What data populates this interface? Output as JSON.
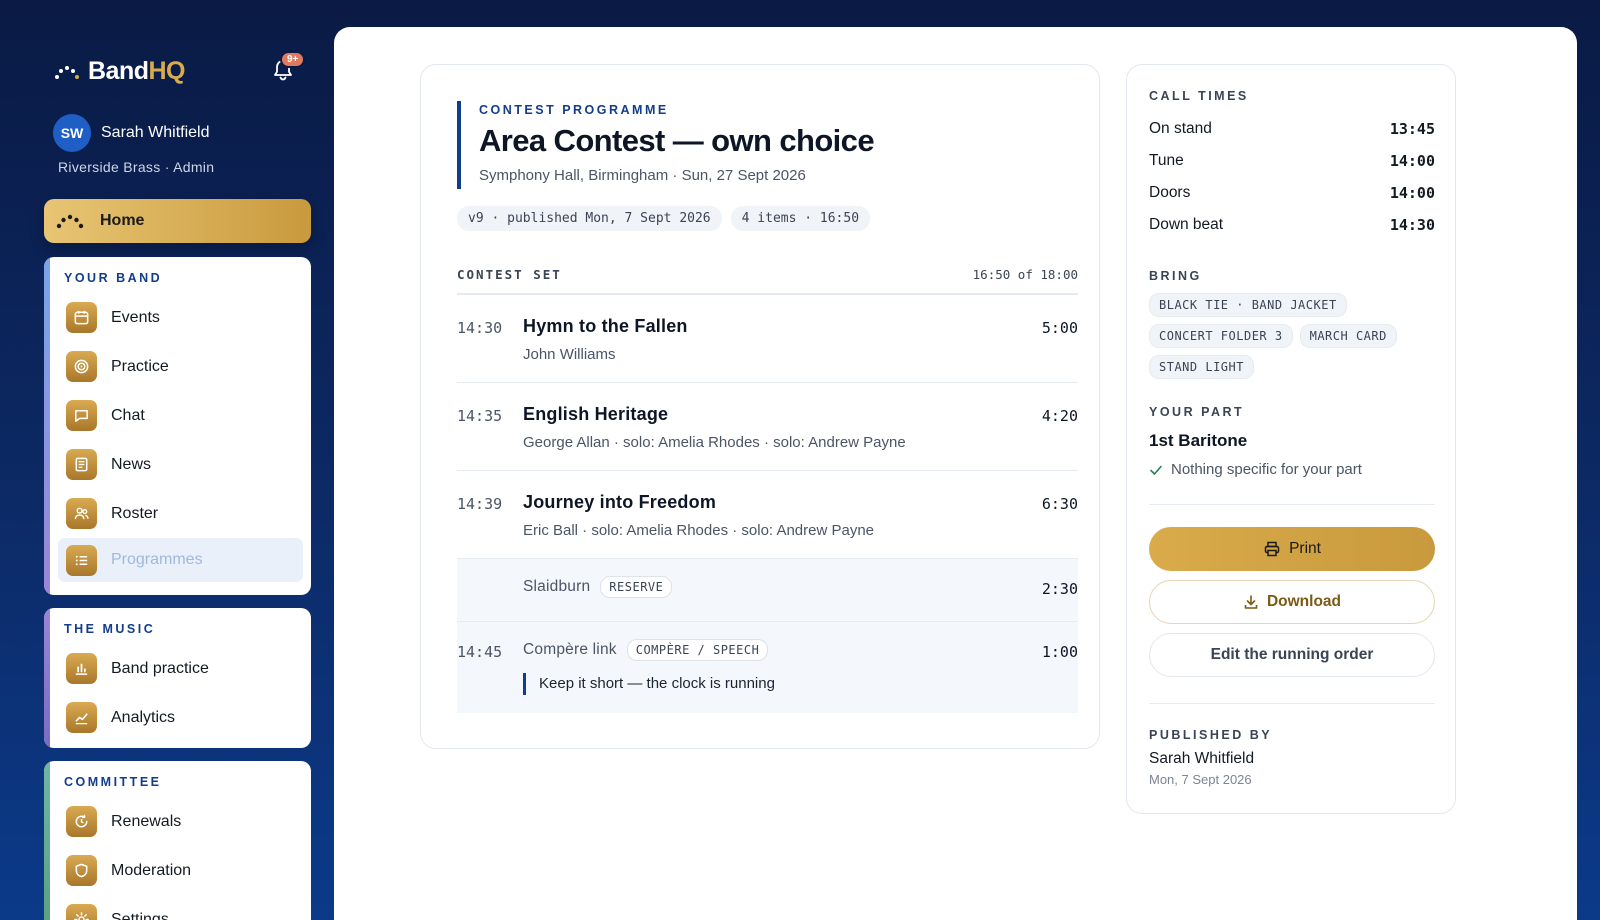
{
  "brand": {
    "name_a": "Band",
    "name_b": "HQ",
    "notifications": "9+"
  },
  "user": {
    "initials": "SW",
    "name": "Sarah Whitfield",
    "subtitle": "Riverside Brass · Admin"
  },
  "nav": {
    "home": "Home",
    "your_band": {
      "heading": "YOUR BAND",
      "items": [
        "Events",
        "Practice",
        "Chat",
        "News",
        "Roster",
        "Programmes"
      ]
    },
    "the_music": {
      "heading": "THE MUSIC",
      "items": [
        "Band practice",
        "Analytics"
      ]
    },
    "committee": {
      "heading": "COMMITTEE",
      "items": [
        "Renewals",
        "Moderation",
        "Settings"
      ]
    }
  },
  "programme": {
    "eyebrow": "CONTEST PROGRAMME",
    "title": "Area Contest — own choice",
    "subtitle": "Symphony Hall, Birmingham · Sun, 27 Sept 2026",
    "chips": [
      "v9 · published Mon, 7 Sept 2026",
      "4 items · 16:50"
    ],
    "set_label": "CONTEST SET",
    "set_total": "16:50 of 18:00",
    "pieces": [
      {
        "time": "14:30",
        "name": "Hymn to the Fallen",
        "composer": "John Williams",
        "duration": "5:00"
      },
      {
        "time": "14:35",
        "name": "English Heritage",
        "composer": "George Allan · solo: Amelia Rhodes · solo: Andrew Payne",
        "duration": "4:20"
      },
      {
        "time": "14:39",
        "name": "Journey into Freedom",
        "composer": "Eric Ball · solo: Amelia Rhodes · solo: Andrew Payne",
        "duration": "6:30"
      }
    ],
    "reserve": {
      "name": "Slaidburn",
      "tag": "RESERVE",
      "duration": "2:30"
    },
    "compere": {
      "time": "14:45",
      "name": "Compère link",
      "tag": "COMPÈRE / SPEECH",
      "duration": "1:00",
      "note": "Keep it short — the clock is running"
    }
  },
  "side": {
    "call_times_label": "CALL TIMES",
    "call_times": [
      {
        "label": "On stand",
        "value": "13:45"
      },
      {
        "label": "Tune",
        "value": "14:00"
      },
      {
        "label": "Doors",
        "value": "14:00"
      },
      {
        "label": "Down beat",
        "value": "14:30"
      }
    ],
    "bring_label": "BRING",
    "bring": [
      "BLACK TIE · BAND JACKET",
      "CONCERT FOLDER 3",
      "MARCH CARD",
      "STAND LIGHT"
    ],
    "part_label": "YOUR PART",
    "part_name": "1st Baritone",
    "part_note": "Nothing specific for your part",
    "print": "Print",
    "download": "Download",
    "edit": "Edit the running order",
    "published_label": "PUBLISHED BY",
    "published_name": "Sarah Whitfield",
    "published_date": "Mon, 7 Sept 2026"
  }
}
